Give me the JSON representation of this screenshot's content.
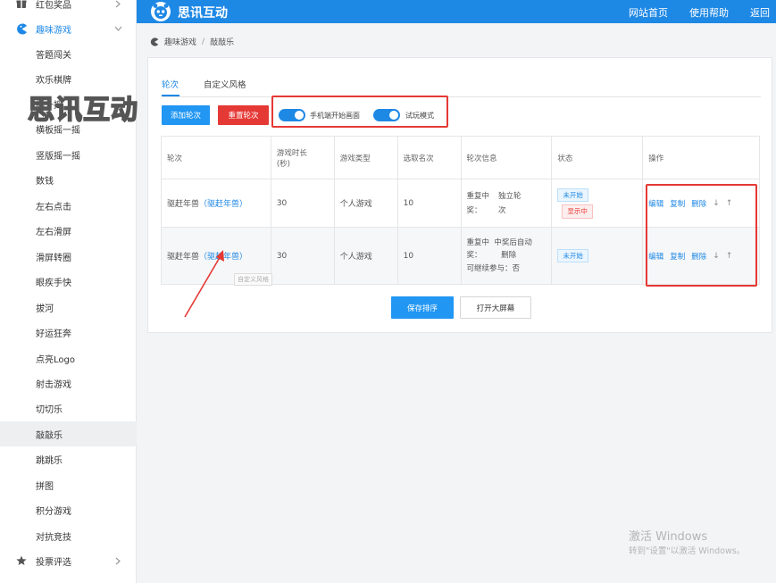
{
  "brand": {
    "name": "思讯互动"
  },
  "watermark": "思讯互动",
  "header": {
    "nav": [
      "网站首页",
      "使用帮助",
      "返回"
    ]
  },
  "sidebar": {
    "items": [
      {
        "label": "红包奖品",
        "icon": "gift-icon"
      },
      {
        "label": "趣味游戏",
        "icon": "pacman-icon"
      },
      {
        "label": "答题闯关"
      },
      {
        "label": "欢乐棋牌"
      },
      {
        "label": "摇一摇"
      },
      {
        "label": "横板摇一摇"
      },
      {
        "label": "竖版摇一摇"
      },
      {
        "label": "数钱"
      },
      {
        "label": "左右点击"
      },
      {
        "label": "左右滑屏"
      },
      {
        "label": "滑屏转圈"
      },
      {
        "label": "眼疾手快"
      },
      {
        "label": "拔河"
      },
      {
        "label": "好运狂奔"
      },
      {
        "label": "点亮Logo"
      },
      {
        "label": "射击游戏"
      },
      {
        "label": "切切乐"
      },
      {
        "label": "敲敲乐"
      },
      {
        "label": "跳跳乐"
      },
      {
        "label": "拼图"
      },
      {
        "label": "积分游戏"
      },
      {
        "label": "对抗竞技"
      },
      {
        "label": "投票评选",
        "icon": "star-icon"
      }
    ]
  },
  "breadcrumb": {
    "parent": "趣味游戏",
    "sep": "/",
    "current": "敲敲乐"
  },
  "tabs": [
    "轮次",
    "自定义风格"
  ],
  "toolbar": {
    "add_round": "添加轮次",
    "reset_round": "重置轮次",
    "toggle_mobile": "手机端开始画面",
    "toggle_trial": "试玩模式"
  },
  "table": {
    "headers": [
      "轮次",
      "游戏时长\n(秒)",
      "游戏类型",
      "选取名次",
      "轮次信息",
      "状态",
      "操作"
    ],
    "rows": [
      {
        "name": "驱赶年兽",
        "link": "（驱赶年兽）",
        "duration": "30",
        "type": "个人游戏",
        "rank": "10",
        "info_a": "重复中\n奖：",
        "info_b": "独立轮\n次",
        "status": [
          "未开始",
          "显示中"
        ]
      },
      {
        "name": "驱赶年兽",
        "link": "（驱赶年兽）",
        "duration": "30",
        "type": "个人游戏",
        "rank": "10",
        "info_a": "重复中  中奖后自动\n奖：        删除\n可继续参与：否",
        "info_b": "",
        "status": [
          "未开始"
        ]
      }
    ],
    "ops": {
      "edit": "编辑",
      "copy": "复制",
      "delete": "删除",
      "down": "↓",
      "up": "↑"
    }
  },
  "tooltip": "自定义风格",
  "buttons": {
    "save_order": "保存排序",
    "open_screen": "打开大屏幕"
  },
  "os_watermark": {
    "line1": "激活 Windows",
    "line2": "转到\"设置\"以激活 Windows。"
  },
  "colors": {
    "primary": "#1e88e5",
    "danger": "#e53935"
  }
}
